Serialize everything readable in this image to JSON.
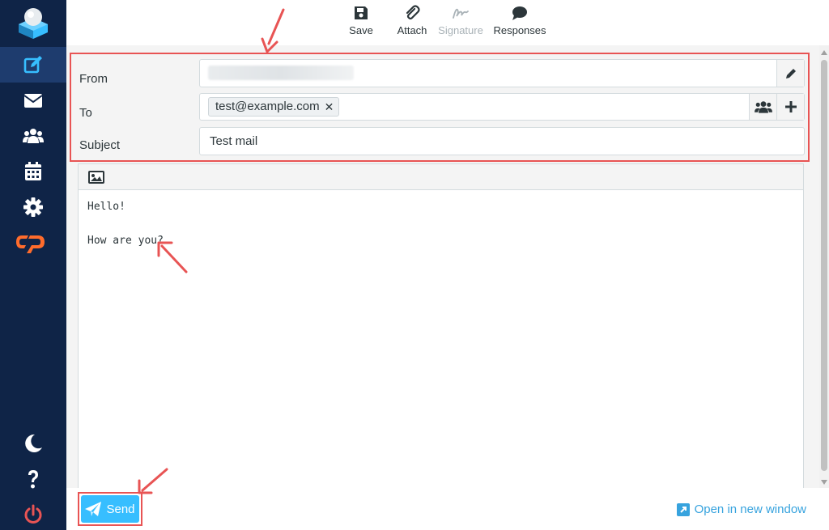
{
  "toolbar": {
    "save": "Save",
    "attach": "Attach",
    "signature": "Signature",
    "responses": "Responses"
  },
  "headers": {
    "from_label": "From",
    "to_label": "To",
    "subject_label": "Subject",
    "recipient": "test@example.com",
    "recipient_remove": "✕",
    "subject_value": "Test mail"
  },
  "editor": {
    "body": "Hello!\n\nHow are you?"
  },
  "footer": {
    "send_label": "Send",
    "open_new_window": "Open in new window"
  },
  "colors": {
    "sidebar": "#0f2447",
    "accent": "#37beff",
    "annotation": "#e85454",
    "cpanel": "#ff6c2c"
  },
  "sidebar_icons": [
    "compose-icon",
    "mail-icon",
    "contacts-icon",
    "calendar-icon",
    "settings-icon",
    "cpanel-icon",
    "dark-mode-icon",
    "help-icon",
    "logout-icon"
  ]
}
